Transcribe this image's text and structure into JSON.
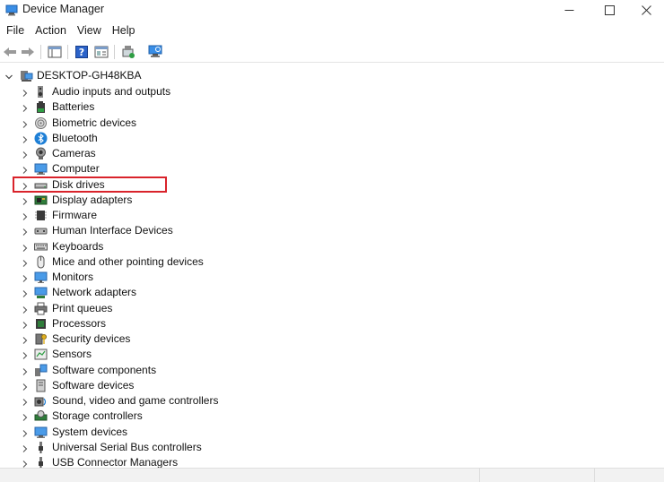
{
  "window": {
    "title": "Device Manager"
  },
  "menu": [
    "File",
    "Action",
    "View",
    "Help"
  ],
  "toolbar": [
    "back-icon",
    "forward-icon",
    "show-hide-console-tree-icon",
    "help-icon",
    "properties-icon",
    "update-driver-icon",
    "scan-hardware-icon"
  ],
  "tree": {
    "root": "DESKTOP-GH48KBA",
    "items": [
      {
        "label": "Audio inputs and outputs",
        "icon": "speaker-icon"
      },
      {
        "label": "Batteries",
        "icon": "battery-icon"
      },
      {
        "label": "Biometric devices",
        "icon": "fingerprint-icon"
      },
      {
        "label": "Bluetooth",
        "icon": "bluetooth-icon"
      },
      {
        "label": "Cameras",
        "icon": "camera-icon"
      },
      {
        "label": "Computer",
        "icon": "computer-icon"
      },
      {
        "label": "Disk drives",
        "icon": "disk-drive-icon",
        "highlighted": true
      },
      {
        "label": "Display adapters",
        "icon": "display-adapter-icon"
      },
      {
        "label": "Firmware",
        "icon": "firmware-icon"
      },
      {
        "label": "Human Interface Devices",
        "icon": "hid-icon"
      },
      {
        "label": "Keyboards",
        "icon": "keyboard-icon"
      },
      {
        "label": "Mice and other pointing devices",
        "icon": "mouse-icon"
      },
      {
        "label": "Monitors",
        "icon": "monitor-icon"
      },
      {
        "label": "Network adapters",
        "icon": "network-adapter-icon"
      },
      {
        "label": "Print queues",
        "icon": "printer-icon"
      },
      {
        "label": "Processors",
        "icon": "processor-icon"
      },
      {
        "label": "Security devices",
        "icon": "security-key-icon"
      },
      {
        "label": "Sensors",
        "icon": "sensor-icon"
      },
      {
        "label": "Software components",
        "icon": "software-component-icon"
      },
      {
        "label": "Software devices",
        "icon": "software-device-icon"
      },
      {
        "label": "Sound, video and game controllers",
        "icon": "sound-icon"
      },
      {
        "label": "Storage controllers",
        "icon": "storage-controller-icon"
      },
      {
        "label": "System devices",
        "icon": "system-device-icon"
      },
      {
        "label": "Universal Serial Bus controllers",
        "icon": "usb-icon"
      },
      {
        "label": "USB Connector Managers",
        "icon": "usb-connector-icon"
      }
    ]
  },
  "colors": {
    "highlight_box": "#d9232b",
    "icon_blue": "#1e7fd6"
  }
}
